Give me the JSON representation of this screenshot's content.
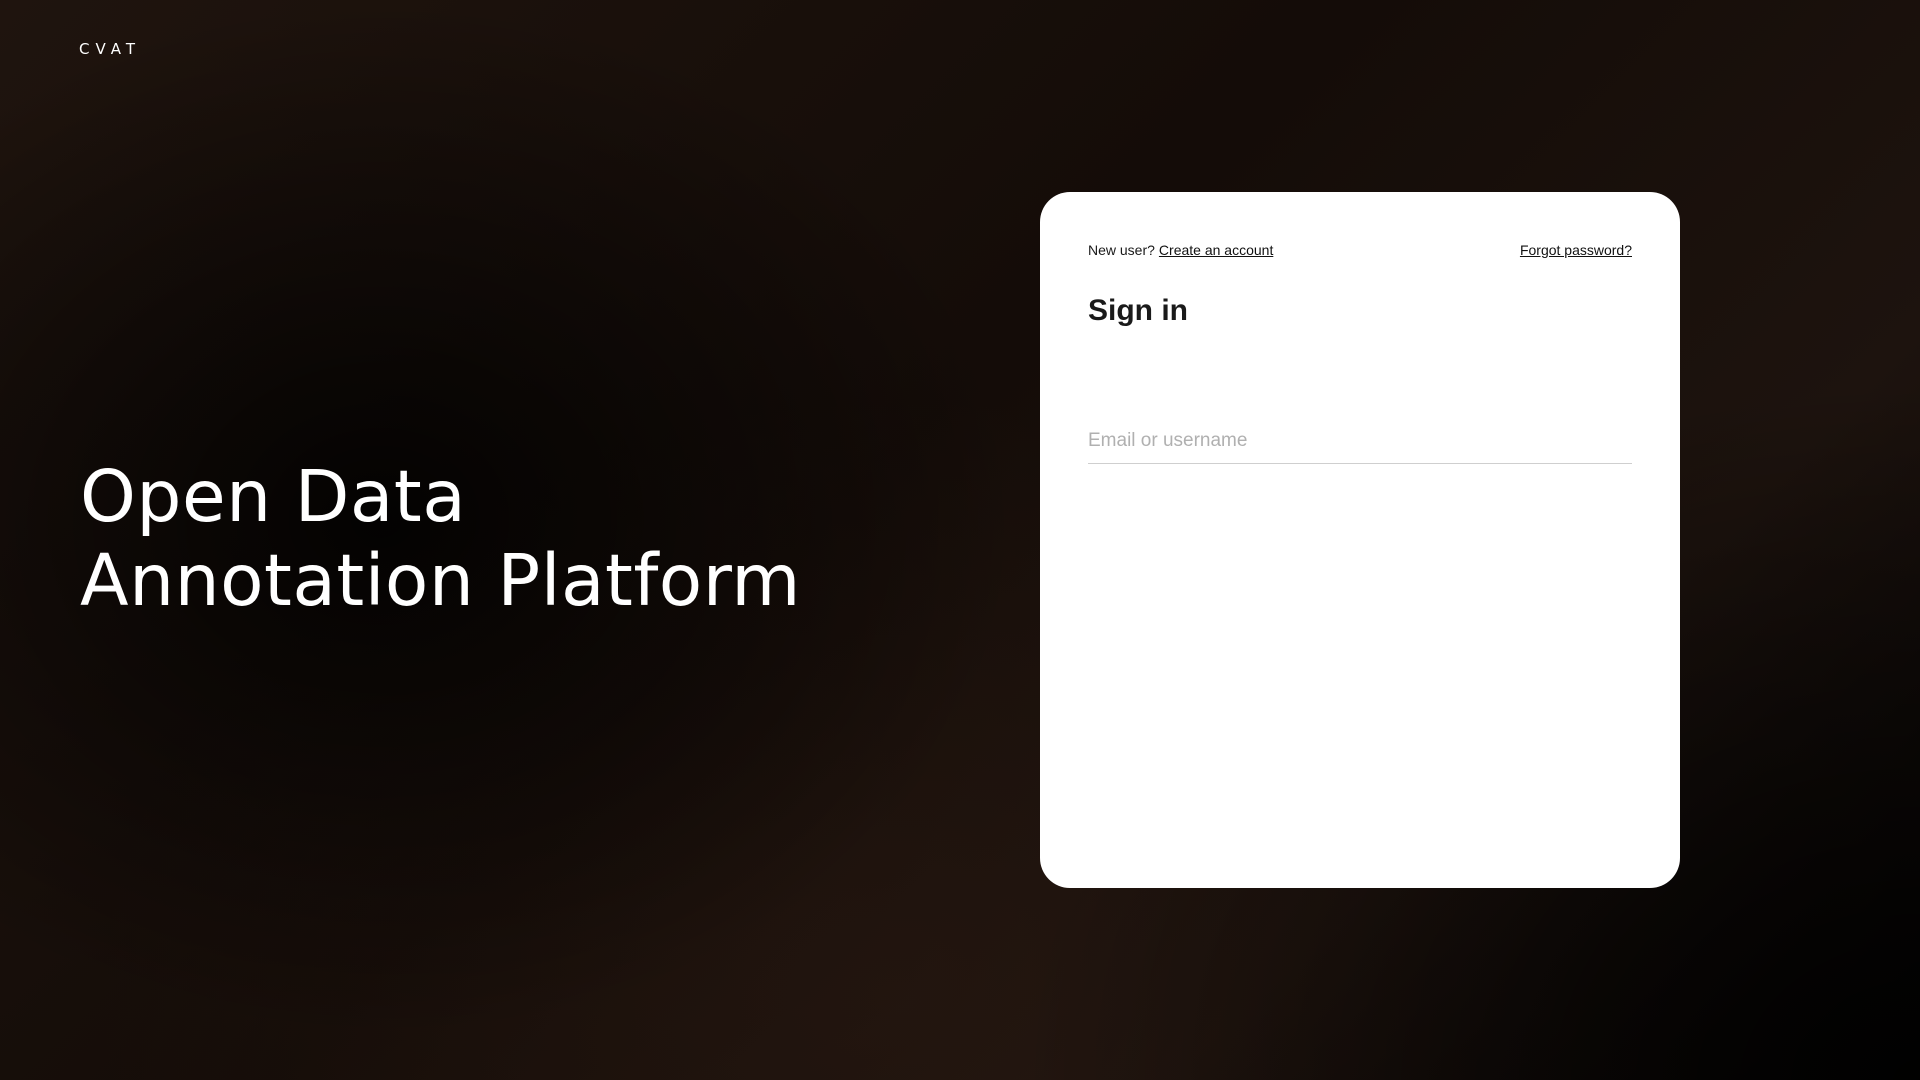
{
  "logo": {
    "text": "CVAT"
  },
  "hero": {
    "line1": "Open Data",
    "line2": "Annotation Platform"
  },
  "signin_card": {
    "new_user_text": "New user?",
    "create_account_link": "Create an account",
    "forgot_password_link": "Forgot password?",
    "title": "Sign in",
    "email_field": {
      "placeholder": "Email or username",
      "value": ""
    }
  },
  "colors": {
    "background": "#140c08",
    "card": "#ffffff",
    "text_dark": "#1a1a1a",
    "placeholder": "#b0b0b0"
  }
}
